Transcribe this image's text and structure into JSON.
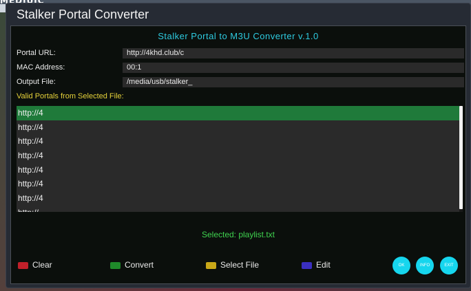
{
  "background": {
    "top_text": "MEDIUIC"
  },
  "window": {
    "title": "Stalker Portal Converter"
  },
  "header": {
    "title": "Stalker Portal to M3U Converter v.1.0"
  },
  "fields": {
    "portal_url": {
      "label": "Portal URL:",
      "value": "http://4khd.club/c"
    },
    "mac_address": {
      "label": "MAC Address:",
      "value": "00:1"
    },
    "output_file": {
      "label": "Output File:",
      "value": "/media/usb/stalker_"
    }
  },
  "list": {
    "heading": "Valid Portals from Selected File:",
    "items": [
      "http://4",
      "http://4",
      "http://4",
      "http://4",
      "http://4",
      "http://4",
      "http://4",
      "http://"
    ],
    "selected_index": 0
  },
  "status": {
    "text": "Selected: playlist.txt"
  },
  "keys": [
    {
      "label": "Clear",
      "color": "#c0202a"
    },
    {
      "label": "Convert",
      "color": "#1f8a2a"
    },
    {
      "label": "Select File",
      "color": "#c9a818"
    },
    {
      "label": "Edit",
      "color": "#3a2fc0"
    }
  ],
  "buttons": {
    "ok": "OK",
    "info": "INFO",
    "exit": "EXIT"
  },
  "colors": {
    "accent_header": "#2ecbe0",
    "selection": "#1f7a3a",
    "status": "#3fd34f",
    "list_heading": "#e6d23a",
    "round_buttons": "#16d6ee"
  }
}
